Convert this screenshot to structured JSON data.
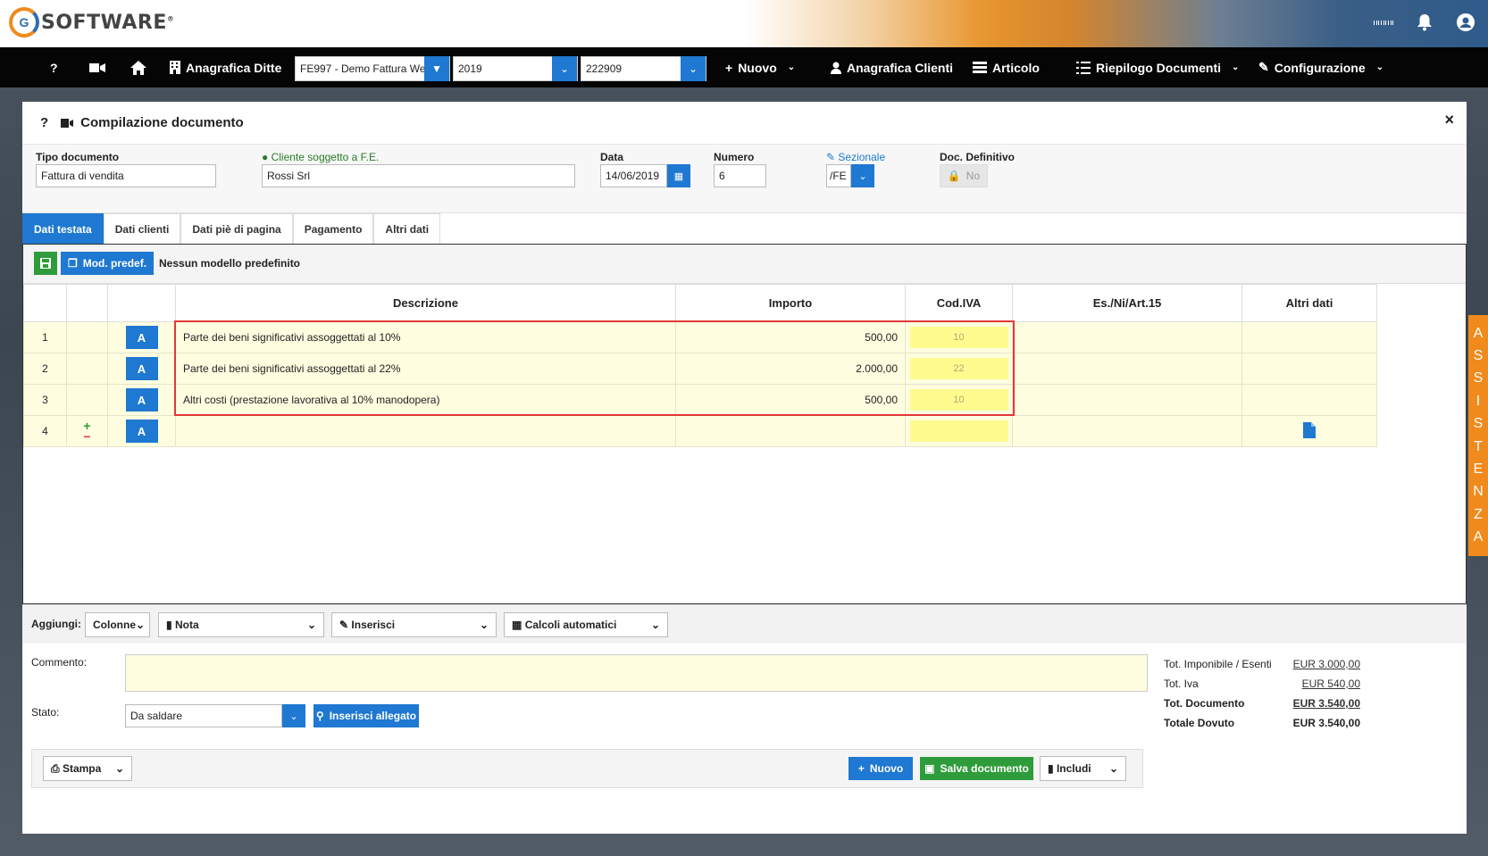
{
  "brand": {
    "logo_letter": "G",
    "logo_text": "SOFTWARE"
  },
  "topbar_icons": [
    "apps-grid-icon",
    "bell-icon",
    "user-icon"
  ],
  "nav": {
    "help": "?",
    "anagrafica_ditte": "Anagrafica Ditte",
    "ditta_select": "FE997 - Demo Fattura Web",
    "year_select": "2019",
    "code_select": "222909",
    "nuovo": "Nuovo",
    "anagrafica_clienti": "Anagrafica Clienti",
    "articolo": "Articolo",
    "riepilogo": "Riepilogo Documenti",
    "configurazione": "Configurazione"
  },
  "panel": {
    "help": "?",
    "title": "Compilazione documento",
    "close": "×"
  },
  "form": {
    "tipo_label": "Tipo documento",
    "tipo_value": "Fattura di vendita",
    "cliente_label": "Cliente soggetto a F.E.",
    "cliente_value": "Rossi Srl",
    "data_label": "Data",
    "data_value": "14/06/2019",
    "numero_label": "Numero",
    "numero_value": "6",
    "sezionale_label": "Sezionale",
    "sezionale_value": "/FE",
    "definitivo_label": "Doc. Definitivo",
    "definitivo_value": "No"
  },
  "tabs": [
    "Dati testata",
    "Dati clienti",
    "Dati piè di pagina",
    "Pagamento",
    "Altri dati"
  ],
  "toolbar": {
    "mod_predef": "Mod. predef.",
    "modello_text": "Nessun modello predefinito"
  },
  "table": {
    "headers": [
      "",
      "",
      "",
      "Descrizione",
      "Importo",
      "Cod.IVA",
      "Es./Ni/Art.15",
      "Altri dati"
    ],
    "rows": [
      {
        "n": "1",
        "a": "A",
        "desc": "Parte dei beni significativi assoggettati al 10%",
        "importo": "500,00",
        "iva": "10"
      },
      {
        "n": "2",
        "a": "A",
        "desc": "Parte dei beni significativi assoggettati al 22%",
        "importo": "2.000,00",
        "iva": "22"
      },
      {
        "n": "3",
        "a": "A",
        "desc": "Altri costi (prestazione lavorativa al 10% manodopera)",
        "importo": "500,00",
        "iva": "10"
      },
      {
        "n": "4",
        "a": "A",
        "desc": "",
        "importo": "",
        "iva": ""
      }
    ],
    "plus": "+",
    "minus": "−"
  },
  "aggiungi": {
    "label": "Aggiungi:",
    "colonne": "Colonne",
    "nota": "Nota",
    "inserisci": "Inserisci",
    "calcoli": "Calcoli automatici"
  },
  "bottom": {
    "commento_label": "Commento:",
    "stato_label": "Stato:",
    "stato_value": "Da saldare",
    "allegato": "Inserisci allegato",
    "stampa": "Stampa",
    "nuovo": "Nuovo",
    "salva": "Salva documento",
    "includi": "Includi"
  },
  "totals": [
    {
      "label": "Tot. Imponibile / Esenti",
      "value": "EUR 3.000,00",
      "bold": false
    },
    {
      "label": "Tot. Iva",
      "value": "EUR 540,00",
      "bold": false
    },
    {
      "label": "Tot. Documento",
      "value": "EUR 3.540,00",
      "bold": true
    },
    {
      "label": "Totale Dovuto",
      "value": "EUR 3.540,00",
      "bold": true
    }
  ],
  "assistenza": [
    "A",
    "S",
    "S",
    "I",
    "S",
    "T",
    "E",
    "N",
    "Z",
    "A"
  ],
  "colors": {
    "accent": "#1f78d1",
    "success": "#2e9c3a",
    "brand_orange": "#f08a1c",
    "highlight": "#e23838"
  }
}
